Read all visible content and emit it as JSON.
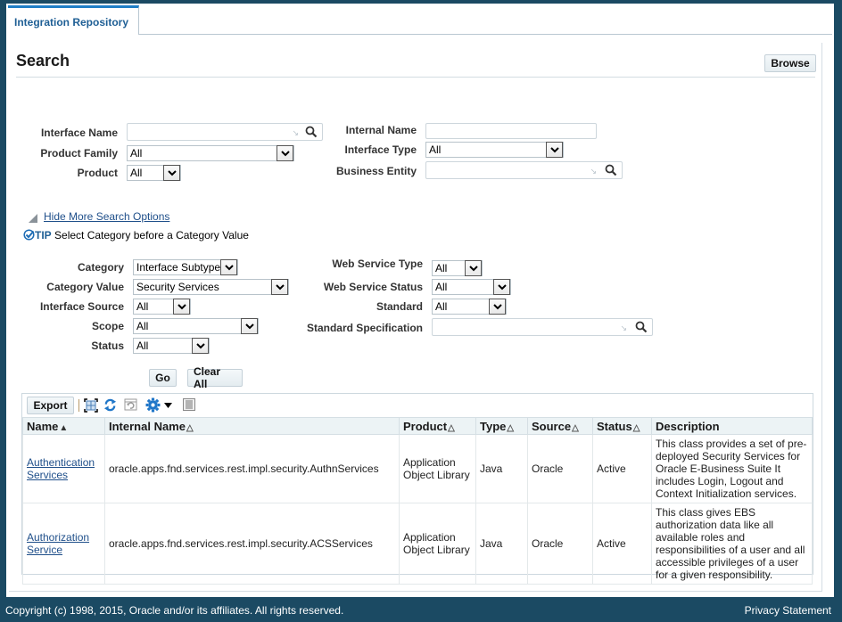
{
  "tabs": [
    {
      "label": "Integration Repository",
      "active": true
    }
  ],
  "page": {
    "title": "Search",
    "browse_label": "Browse"
  },
  "basic_search": {
    "interface_name": {
      "label": "Interface Name",
      "value": ""
    },
    "product_family": {
      "label": "Product Family",
      "value": "All"
    },
    "product": {
      "label": "Product",
      "value": "All"
    },
    "internal_name": {
      "label": "Internal Name",
      "value": ""
    },
    "interface_type": {
      "label": "Interface Type",
      "value": "All"
    },
    "business_entity": {
      "label": "Business Entity",
      "value": ""
    }
  },
  "more_options": {
    "toggle_label": "Hide More Search Options",
    "tip_prefix": "TIP",
    "tip_text": "Select Category before a Category Value",
    "category": {
      "label": "Category",
      "value": "Interface Subtype"
    },
    "category_value": {
      "label": "Category Value",
      "value": "Security Services"
    },
    "interface_source": {
      "label": "Interface Source",
      "value": "All"
    },
    "scope": {
      "label": "Scope",
      "value": "All"
    },
    "status": {
      "label": "Status",
      "value": "All"
    },
    "web_service_type": {
      "label": "Web Service Type",
      "value": "All"
    },
    "web_service_status": {
      "label": "Web Service Status",
      "value": "All"
    },
    "standard": {
      "label": "Standard",
      "value": "All"
    },
    "standard_specification": {
      "label": "Standard Specification",
      "value": ""
    }
  },
  "actions": {
    "go_label": "Go",
    "clear_label": "Clear All"
  },
  "results": {
    "export_label": "Export",
    "toolbar_icons": [
      "detach-icon",
      "refresh-icon",
      "freeze-icon",
      "settings-icon",
      "columns-icon"
    ],
    "columns": [
      "Name",
      "Internal Name",
      "Product",
      "Type",
      "Source",
      "Status",
      "Description"
    ],
    "rows": [
      {
        "name": "Authentication Services",
        "internal_name": "oracle.apps.fnd.services.rest.impl.security.AuthnServices",
        "product": "Application Object Library",
        "type": "Java",
        "source": "Oracle",
        "status": "Active",
        "description": "This class provides a set of pre-deployed Security Services for Oracle E-Business Suite It includes Login, Logout and Context Initialization services."
      },
      {
        "name": "Authorization Service",
        "internal_name": "oracle.apps.fnd.services.rest.impl.security.ACSServices",
        "product": "Application Object Library",
        "type": "Java",
        "source": "Oracle",
        "status": "Active",
        "description": "This class gives EBS authorization data like all available roles and responsibilities of a user and all accessible privileges of a user for a given responsibility."
      }
    ]
  },
  "footer": {
    "copyright": "Copyright (c) 1998, 2015, Oracle and/or its affiliates. All rights reserved.",
    "privacy": "Privacy Statement"
  },
  "colors": {
    "frame": "#1b4a63",
    "tab_accent": "#1f7ec6",
    "link": "#1f4f8a",
    "header_bg": "#ecf3f5"
  }
}
